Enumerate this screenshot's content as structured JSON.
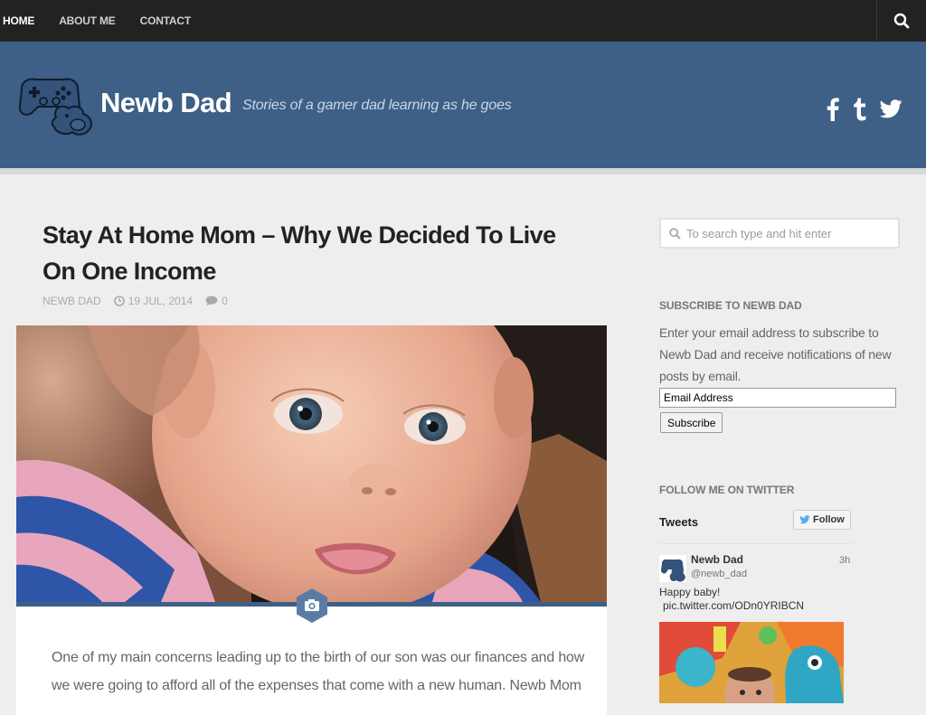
{
  "nav": {
    "items": [
      {
        "label": "HOME"
      },
      {
        "label": "ABOUT ME"
      },
      {
        "label": "CONTACT"
      }
    ],
    "search_icon": "search-icon"
  },
  "header": {
    "site_title": "Newb Dad",
    "tagline": "Stories of a gamer dad learning as he goes",
    "logo_icon": "gamepad-logo-icon",
    "social": [
      "facebook-icon",
      "tumblr-icon",
      "twitter-icon"
    ]
  },
  "post": {
    "title": "Stay At Home Mom – Why We Decided To Live On One Income",
    "author": "NEWB DAD",
    "date": "19 JUL, 2014",
    "comments": "0",
    "excerpt": "One of my main concerns leading up to the birth of our son was our finances and how we were going to afford all of the expenses that come with a new human. Newb Mom"
  },
  "sidebar": {
    "search_placeholder": "To search type and hit enter",
    "subscribe": {
      "title": "SUBSCRIBE TO NEWB DAD",
      "text": "Enter your email address to subscribe to Newb Dad and receive notifications of new posts by email.",
      "email_value": "Email Address",
      "button": "Subscribe"
    },
    "twitter": {
      "title": "FOLLOW ME ON TWITTER",
      "tweets_label": "Tweets",
      "follow_label": "Follow",
      "tweet": {
        "name": "Newb Dad",
        "handle": "@newb_dad",
        "time": "3h",
        "text": "Happy baby!",
        "link": "pic.twitter.com/ODn0YRIBCN"
      }
    }
  },
  "colors": {
    "topbar": "#222222",
    "header": "#3e5f86",
    "accent": "#3e5f86",
    "twitter": "#55acee"
  }
}
